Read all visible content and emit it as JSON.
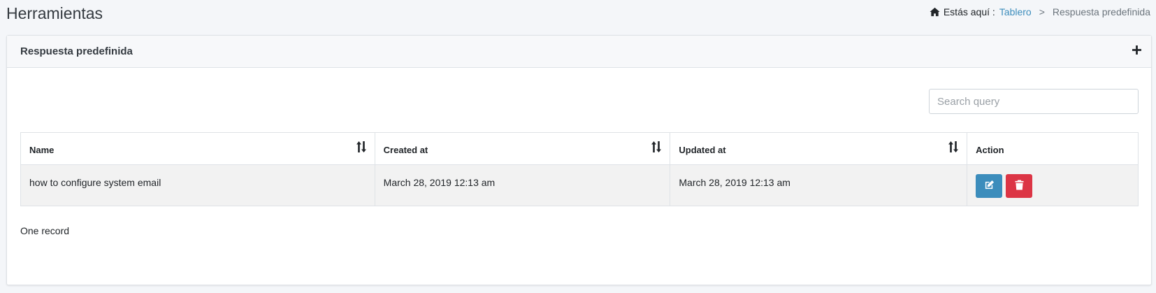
{
  "page": {
    "title": "Herramientas"
  },
  "breadcrumb": {
    "prefix": "Estás aquí :",
    "link": "Tablero",
    "separator": ">",
    "current": "Respuesta predefinida"
  },
  "card": {
    "title": "Respuesta predefinida",
    "add_icon": "plus-icon"
  },
  "search": {
    "placeholder": "Search query",
    "value": ""
  },
  "table": {
    "columns": [
      "Name",
      "Created at",
      "Updated at",
      "Action"
    ],
    "rows": [
      {
        "name": "how to configure system email",
        "created_at": "March 28, 2019 12:13 am",
        "updated_at": "March 28, 2019 12:13 am",
        "actions": [
          "edit-icon",
          "trash-icon"
        ]
      }
    ]
  },
  "footer": {
    "record_count": "One record"
  },
  "colors": {
    "link": "#3c8dbc",
    "edit_button": "#3c8dbc",
    "delete_button": "#dc3545",
    "page_background": "#f4f6f9"
  }
}
